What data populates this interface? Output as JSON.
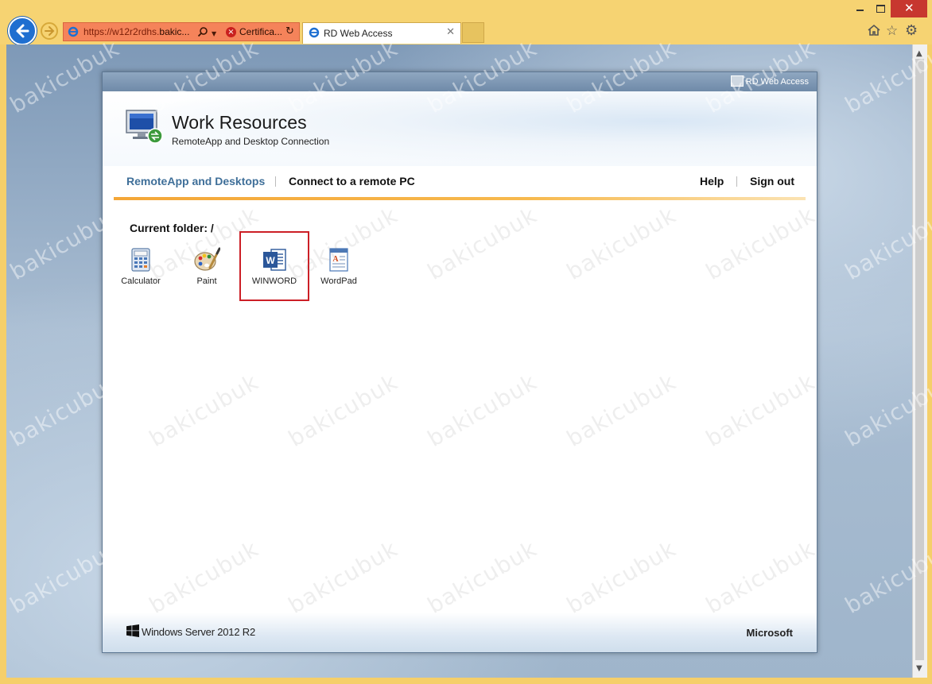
{
  "browser": {
    "address": {
      "url_prefix": "https://w12r2rdhs.",
      "url_host": "bakic...",
      "certificate": "Certifica..."
    },
    "tab": {
      "title": "RD Web Access",
      "close": "✕"
    }
  },
  "rdwa": {
    "brand_label": "RD Web Access",
    "title": "Work Resources",
    "subtitle": "RemoteApp and Desktop Connection",
    "nav": {
      "remoteapp": "RemoteApp and Desktops",
      "connect": "Connect to a remote PC",
      "help": "Help",
      "signout": "Sign out"
    },
    "folder_label": "Current folder: /",
    "apps": [
      {
        "label": "Calculator",
        "icon": "calculator-icon"
      },
      {
        "label": "Paint",
        "icon": "paint-palette-icon"
      },
      {
        "label": "WINWORD",
        "icon": "word-icon",
        "selected": true
      },
      {
        "label": "WordPad",
        "icon": "wordpad-icon"
      }
    ],
    "footer_left": "Windows Server 2012 R2",
    "footer_right": "Microsoft"
  },
  "watermark": "bakicubuk",
  "colors": {
    "accent_orange": "#f4a637",
    "nav_active": "#3f6f99",
    "selection": "#cc1f26",
    "ie_frame": "#f6d372"
  }
}
